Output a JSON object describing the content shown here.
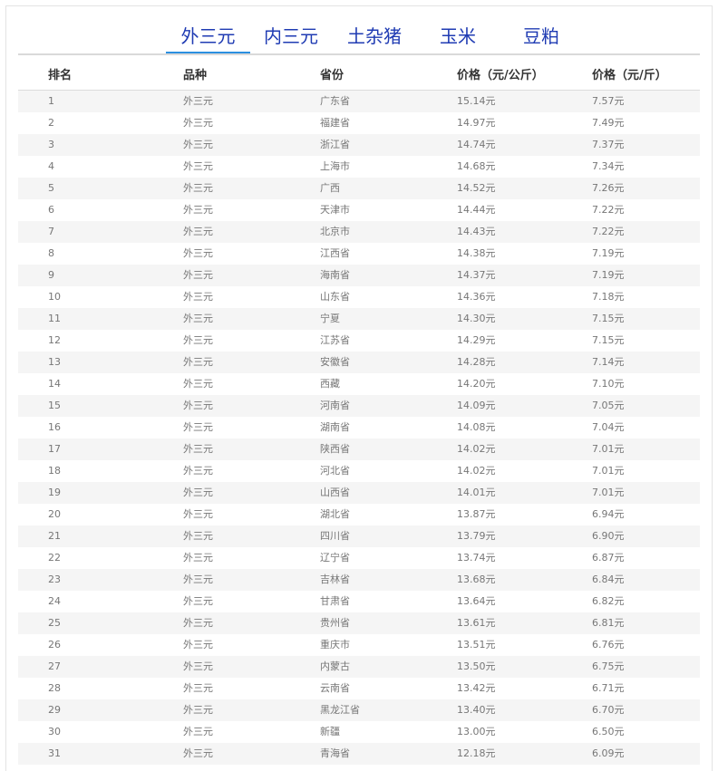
{
  "tabs": [
    {
      "label": "外三元",
      "active": true
    },
    {
      "label": "内三元",
      "active": false
    },
    {
      "label": "土杂猪",
      "active": false
    },
    {
      "label": "玉米",
      "active": false
    },
    {
      "label": "豆粕",
      "active": false
    }
  ],
  "table": {
    "headers": [
      "排名",
      "品种",
      "省份",
      "价格（元/公斤）",
      "价格（元/斤）"
    ],
    "rows": [
      [
        "1",
        "外三元",
        "广东省",
        "15.14元",
        "7.57元"
      ],
      [
        "2",
        "外三元",
        "福建省",
        "14.97元",
        "7.49元"
      ],
      [
        "3",
        "外三元",
        "浙江省",
        "14.74元",
        "7.37元"
      ],
      [
        "4",
        "外三元",
        "上海市",
        "14.68元",
        "7.34元"
      ],
      [
        "5",
        "外三元",
        "广西",
        "14.52元",
        "7.26元"
      ],
      [
        "6",
        "外三元",
        "天津市",
        "14.44元",
        "7.22元"
      ],
      [
        "7",
        "外三元",
        "北京市",
        "14.43元",
        "7.22元"
      ],
      [
        "8",
        "外三元",
        "江西省",
        "14.38元",
        "7.19元"
      ],
      [
        "9",
        "外三元",
        "海南省",
        "14.37元",
        "7.19元"
      ],
      [
        "10",
        "外三元",
        "山东省",
        "14.36元",
        "7.18元"
      ],
      [
        "11",
        "外三元",
        "宁夏",
        "14.30元",
        "7.15元"
      ],
      [
        "12",
        "外三元",
        "江苏省",
        "14.29元",
        "7.15元"
      ],
      [
        "13",
        "外三元",
        "安徽省",
        "14.28元",
        "7.14元"
      ],
      [
        "14",
        "外三元",
        "西藏",
        "14.20元",
        "7.10元"
      ],
      [
        "15",
        "外三元",
        "河南省",
        "14.09元",
        "7.05元"
      ],
      [
        "16",
        "外三元",
        "湖南省",
        "14.08元",
        "7.04元"
      ],
      [
        "17",
        "外三元",
        "陕西省",
        "14.02元",
        "7.01元"
      ],
      [
        "18",
        "外三元",
        "河北省",
        "14.02元",
        "7.01元"
      ],
      [
        "19",
        "外三元",
        "山西省",
        "14.01元",
        "7.01元"
      ],
      [
        "20",
        "外三元",
        "湖北省",
        "13.87元",
        "6.94元"
      ],
      [
        "21",
        "外三元",
        "四川省",
        "13.79元",
        "6.90元"
      ],
      [
        "22",
        "外三元",
        "辽宁省",
        "13.74元",
        "6.87元"
      ],
      [
        "23",
        "外三元",
        "吉林省",
        "13.68元",
        "6.84元"
      ],
      [
        "24",
        "外三元",
        "甘肃省",
        "13.64元",
        "6.82元"
      ],
      [
        "25",
        "外三元",
        "贵州省",
        "13.61元",
        "6.81元"
      ],
      [
        "26",
        "外三元",
        "重庆市",
        "13.51元",
        "6.76元"
      ],
      [
        "27",
        "外三元",
        "内蒙古",
        "13.50元",
        "6.75元"
      ],
      [
        "28",
        "外三元",
        "云南省",
        "13.42元",
        "6.71元"
      ],
      [
        "29",
        "外三元",
        "黑龙江省",
        "13.40元",
        "6.70元"
      ],
      [
        "30",
        "外三元",
        "新疆",
        "13.00元",
        "6.50元"
      ],
      [
        "31",
        "外三元",
        "青海省",
        "12.18元",
        "6.09元"
      ]
    ]
  },
  "colors": {
    "tab_text": "#1f3bb3",
    "tab_underline": "#2b8fe0",
    "stripe": "#f5f5f5"
  }
}
